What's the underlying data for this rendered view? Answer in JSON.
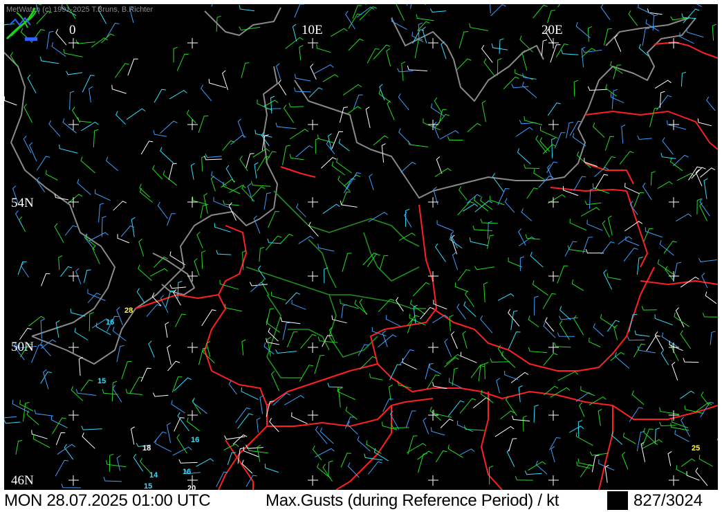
{
  "app": {
    "copyright": "MetWatch  (c) 1991-2025 T.Bruns, B.Richter",
    "logo": "metwatch-logo-icon"
  },
  "map": {
    "background": "#000000",
    "colors": {
      "coastline": "#8a8a8a",
      "country_border": "#ff2020",
      "state_border": "#1f8f1f",
      "grid_cross": "#ffffff",
      "barb_low": "#20e020",
      "barb_mid": "#3fa0ff",
      "barb_cyan": "#30e0ff",
      "barb_high": "#ffffff",
      "barb_yellow": "#ffff40"
    },
    "longitude_labels": [
      "0",
      "10E",
      "20E"
    ],
    "latitude_labels": [
      "54N",
      "50N",
      "46N"
    ],
    "station_values": [
      {
        "text": "28",
        "color": "#ffff40"
      },
      {
        "text": "16",
        "color": "#30e0ff"
      },
      {
        "text": "15",
        "color": "#30e0ff"
      },
      {
        "text": "16",
        "color": "#30e0ff"
      },
      {
        "text": "18",
        "color": "#ffffff"
      },
      {
        "text": "14",
        "color": "#30e0ff"
      },
      {
        "text": "16",
        "color": "#30e0ff"
      },
      {
        "text": "15",
        "color": "#30e0ff"
      },
      {
        "text": "20",
        "color": "#ffffff"
      },
      {
        "text": "25",
        "color": "#ffff40"
      }
    ]
  },
  "status": {
    "date": "MON 28.07.2025 01:00 UTC",
    "parameter": "Max.Gusts (during Reference Period) / kt",
    "count": "827/3024"
  }
}
